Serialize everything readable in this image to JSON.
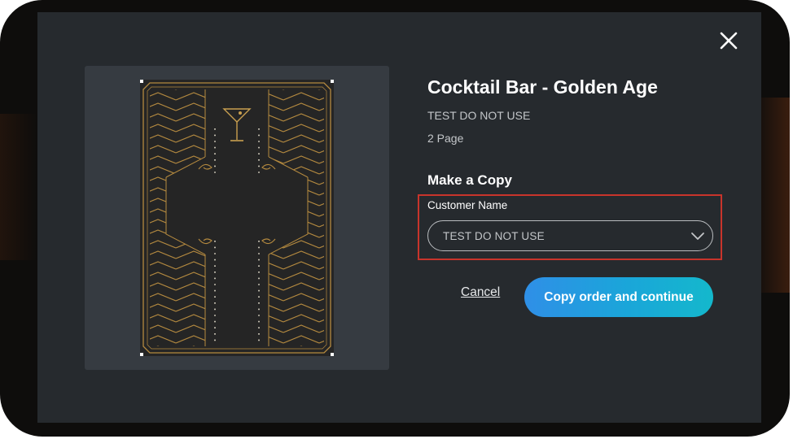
{
  "dialog": {
    "close_icon": "close-icon",
    "title": "Cocktail Bar - Golden Age",
    "subtitle": "TEST DO NOT USE",
    "page_count": "2 Page",
    "preview_icon": "art-deco-menu-cover"
  },
  "copy_section": {
    "heading": "Make a Copy",
    "customer_label": "Customer Name",
    "customer_value": "TEST DO NOT USE",
    "dropdown_icon": "chevron-down-icon"
  },
  "actions": {
    "cancel_label": "Cancel",
    "primary_label": "Copy order and continue"
  },
  "colors": {
    "modal_bg": "#262a2e",
    "preview_bg": "#363b41",
    "gold": "#b58a3f",
    "highlight_border": "#c8342b",
    "button_gradient_start": "#2f8fe7",
    "button_gradient_end": "#14b8cc"
  }
}
